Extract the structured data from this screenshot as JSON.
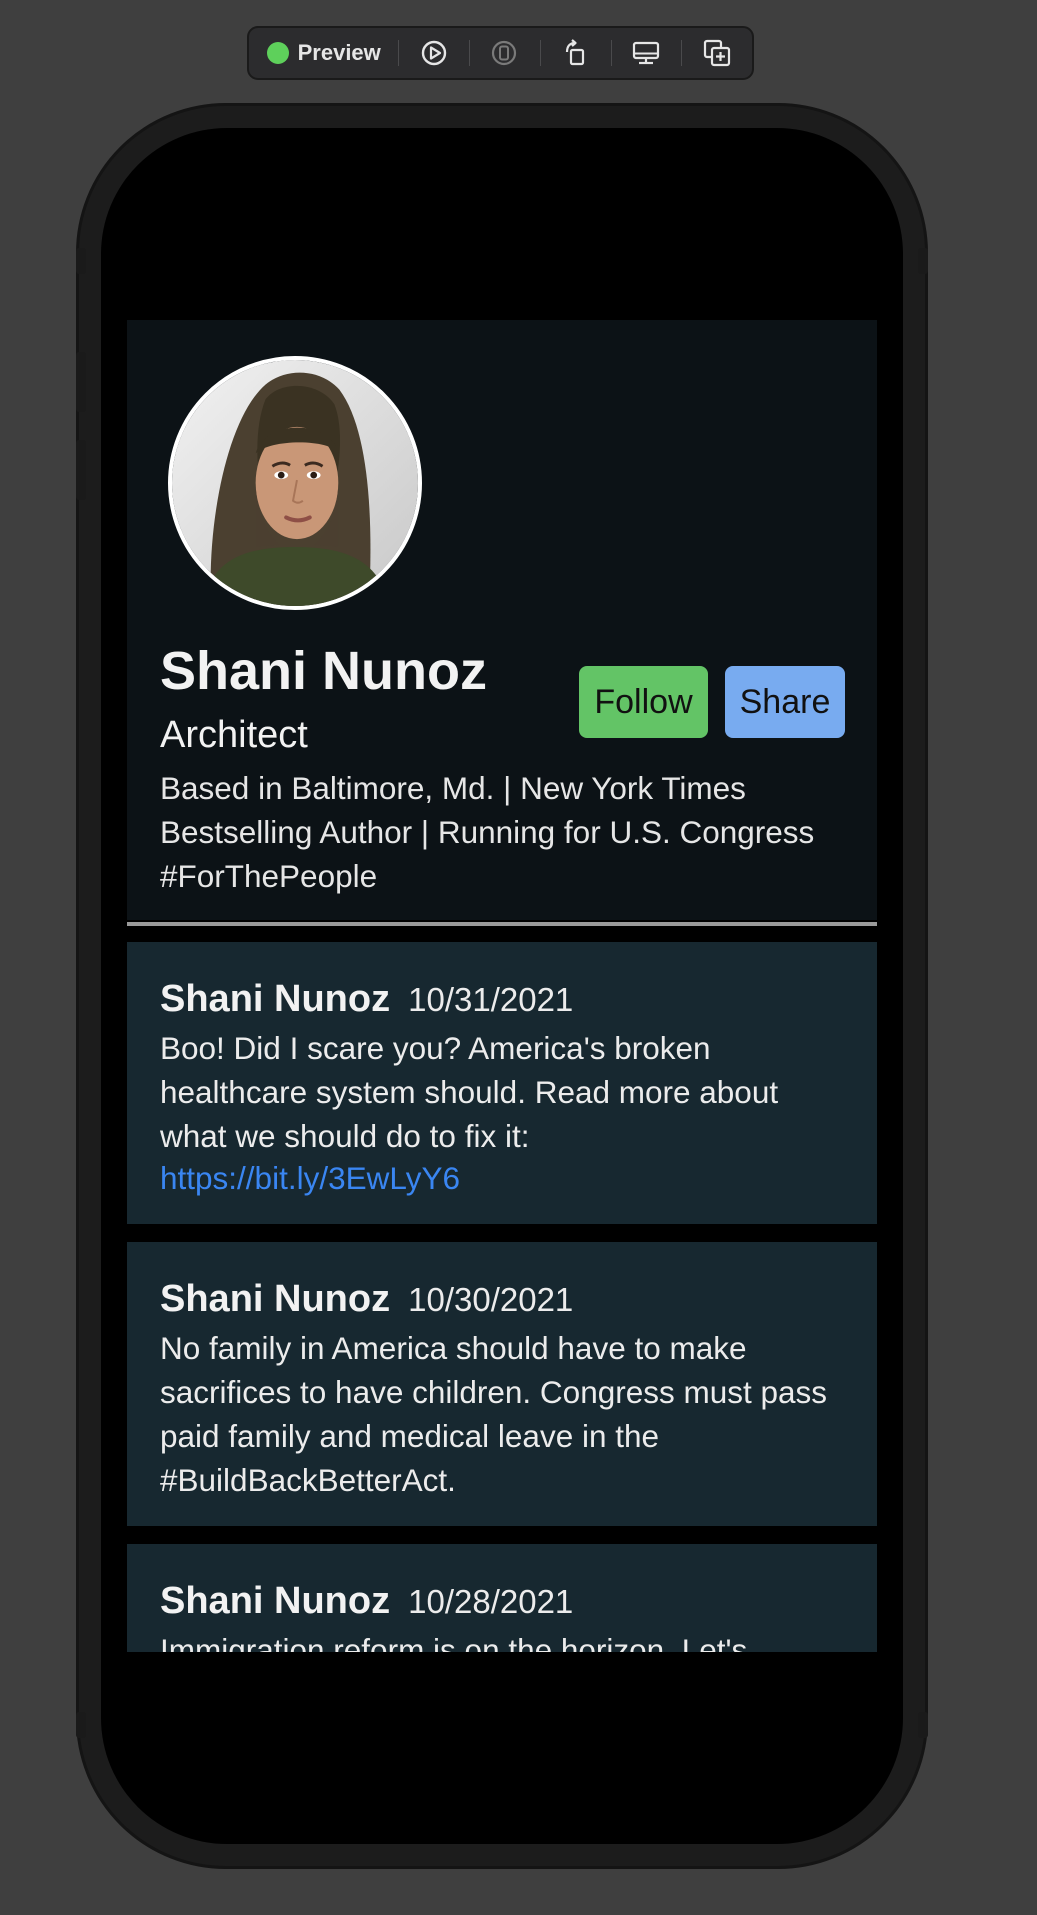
{
  "toolbar": {
    "preview_label": "Preview",
    "status_color": "#5ed05b",
    "icons": [
      "live-play-icon",
      "device-select-icon",
      "rotate-icon",
      "device-settings-icon",
      "duplicate-icon"
    ]
  },
  "profile": {
    "name": "Shani Nunoz",
    "title": "Architect",
    "bio": "Based in Baltimore, Md. | New York Times Bestselling Author | Running for U.S. Congress #ForThePeople",
    "follow_label": "Follow",
    "share_label": "Share",
    "follow_color": "#63c466",
    "share_color": "#78abf0"
  },
  "posts": [
    {
      "author": "Shani Nunoz",
      "date": "10/31/2021",
      "text": "Boo! Did I scare you? America's broken healthcare system should. Read more about what we should do to fix it:",
      "link": "https://bit.ly/3EwLyY6"
    },
    {
      "author": "Shani Nunoz",
      "date": "10/30/2021",
      "text": "No family in America should have to make sacrifices to have children. Congress must pass paid family and medical leave in the #BuildBackBetterAct."
    },
    {
      "author": "Shani Nunoz",
      "date": "10/28/2021",
      "text": "Immigration reform is on the horizon. Let's"
    }
  ]
}
